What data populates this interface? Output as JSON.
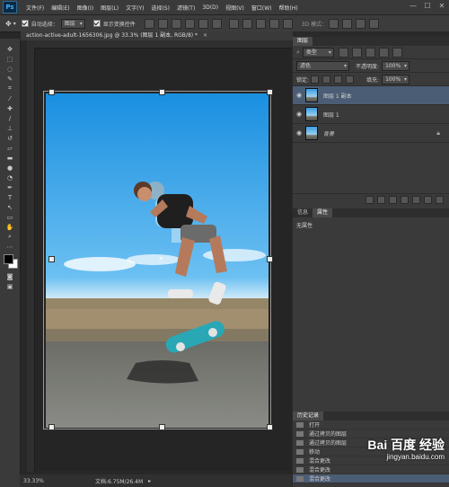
{
  "menu": {
    "logo": "Ps",
    "items": [
      "文件(F)",
      "编辑(E)",
      "图像(I)",
      "图层(L)",
      "文字(Y)",
      "选择(S)",
      "滤镜(T)",
      "3D(D)",
      "视图(V)",
      "窗口(W)",
      "帮助(H)"
    ],
    "win_min": "—",
    "win_max": "☐",
    "win_close": "✕"
  },
  "options": {
    "auto_select_label": "自动选择：",
    "auto_select_value": "图层",
    "show_transform_label": "显示变换控件",
    "mode_3d_label": "3D 模式："
  },
  "document": {
    "tab_title": "action-active-adult-1656306.jpg @ 33.3% (图层 1 副本, RGB/8) *"
  },
  "status": {
    "zoom": "33.33%",
    "doc_info": "文档:6.75M/26.4M"
  },
  "layers_panel": {
    "tab": "图层",
    "filter_kind": "类型",
    "blend_mode": "滤色",
    "opacity_label": "不透明度:",
    "opacity_value": "100%",
    "lock_label": "锁定:",
    "fill_label": "填充:",
    "fill_value": "100%",
    "layers": [
      {
        "name": "图层 1 副本",
        "selected": true
      },
      {
        "name": "图层 1",
        "selected": false
      },
      {
        "name": "背景",
        "selected": false,
        "locked": true
      }
    ]
  },
  "properties_panel": {
    "tabs": [
      "信息",
      "属性"
    ],
    "active_tab": "属性",
    "empty_text": "无属性"
  },
  "history_panel": {
    "tab": "历史记录",
    "items": [
      "打开",
      "通过拷贝的图层",
      "通过拷贝的图层",
      "移动",
      "混合更改",
      "混合更改",
      "混合更改"
    ]
  },
  "watermark": {
    "brand": "Bai 百度 经验",
    "url": "jingyan.baidu.com"
  },
  "colors": {
    "accent_selected": "#4b5d74"
  }
}
